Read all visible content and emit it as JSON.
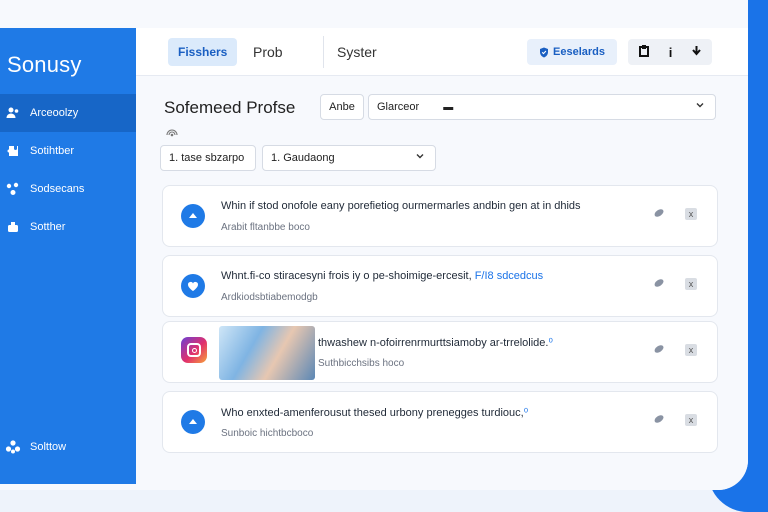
{
  "sidebar": {
    "brand": "Sonusy",
    "items": [
      {
        "label": "Arceoolzy",
        "icon": "people-icon"
      },
      {
        "label": "Sotihtber",
        "icon": "puzzle-icon"
      },
      {
        "label": "Sodsecans",
        "icon": "network-icon"
      },
      {
        "label": "Sotther",
        "icon": "box-icon"
      }
    ],
    "bottom_item": {
      "label": "Solttow",
      "icon": "group-icon"
    }
  },
  "topbar": {
    "tabs": [
      "Fisshers",
      "Prob",
      "Syster"
    ],
    "action_label": "Eeselards",
    "icon_buttons": [
      "import-icon",
      "info-icon",
      "download-icon"
    ]
  },
  "page": {
    "title": "Sofemeed Profse",
    "filter1": "Anbe",
    "filter2": "Glarceor",
    "select1": "1. tase sbzarpo",
    "select2": "1. Gaudaong"
  },
  "cards": [
    {
      "title": "Whin if stod onofole eany porefietiog ourmermarles andbin gen at in dhids",
      "link": "",
      "subtitle": "Arabit fltanbbe boco",
      "icon": "upload-icon"
    },
    {
      "title": "Whnt.fi-co stiracesyni frois iy o pe-shoimige-ercesit, ",
      "link": "F/I8 sdcedcus",
      "subtitle": "Ardkiodsbtiabemodgb",
      "icon": "heart-icon"
    },
    {
      "title": "thwashew n-ofoirrenrmurttsiamoby ar-trrelolide.",
      "link": "⁰",
      "subtitle": "Suthbicchsibs hoco",
      "icon": "instagram-icon"
    },
    {
      "title": "Who enxted-amenferousut thesed urbony prenegges turdiouc,",
      "link": "⁰",
      "subtitle": "Sunboic hichtbcboco",
      "icon": "upload-icon"
    }
  ]
}
